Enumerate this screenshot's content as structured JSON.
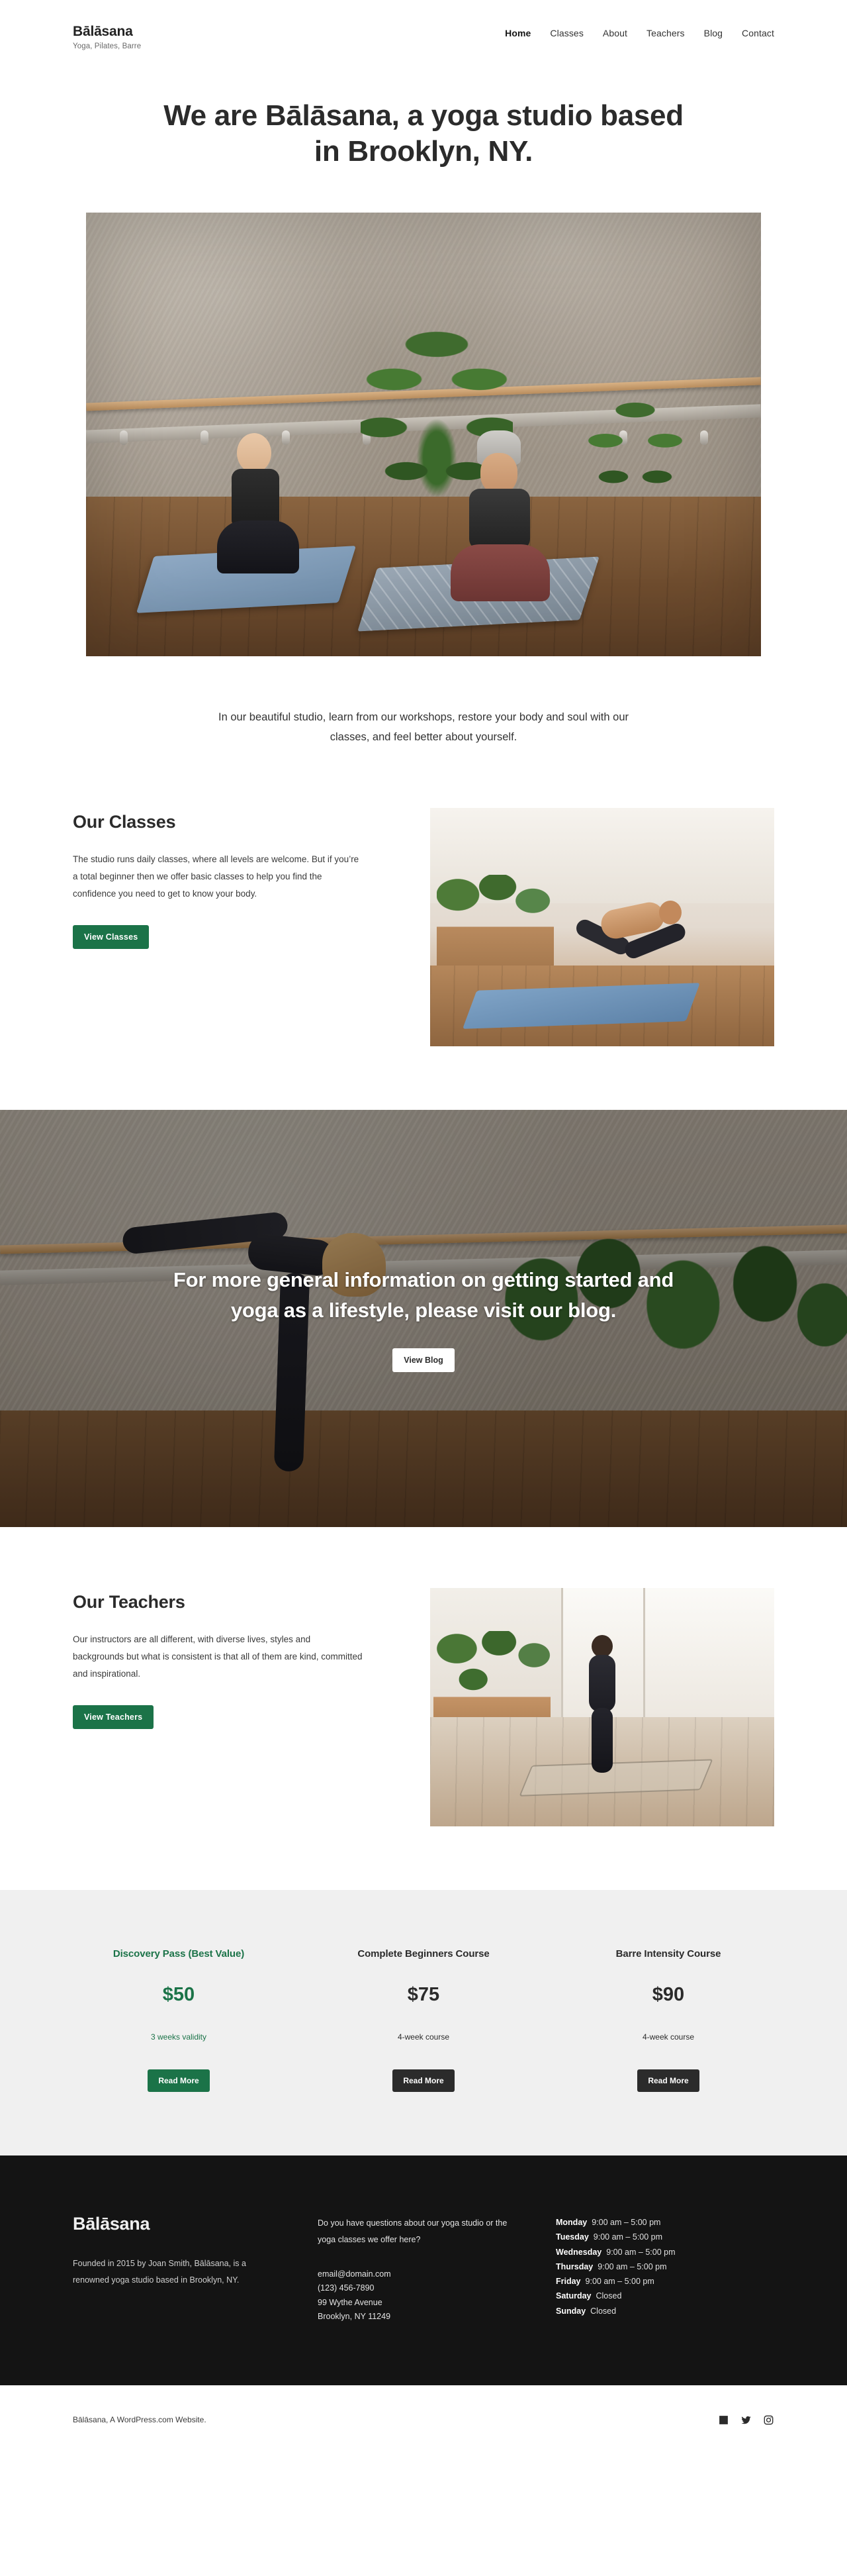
{
  "header": {
    "brand_title": "Bālāsana",
    "brand_tagline": "Yoga, Pilates, Barre",
    "nav": [
      {
        "label": "Home",
        "active": true
      },
      {
        "label": "Classes",
        "active": false
      },
      {
        "label": "About",
        "active": false
      },
      {
        "label": "Teachers",
        "active": false
      },
      {
        "label": "Blog",
        "active": false
      },
      {
        "label": "Contact",
        "active": false
      }
    ]
  },
  "hero": {
    "heading": "We are Bālāsana, a yoga studio based in Brooklyn, NY.",
    "image_alt": "Two people meditating cross-legged on yoga mats in a studio with concrete walls, a wooden barre and large palm plants",
    "intro": "In our beautiful studio, learn from our workshops, restore your body and soul with our classes, and feel better about yourself."
  },
  "classes_section": {
    "heading": "Our Classes",
    "body": "The studio runs daily classes, where all levels are welcome. But if you’re a total beginner then we offer basic classes to help you find the confidence you need to get to know your body.",
    "button_label": "View Classes",
    "image_alt": "Person in extended side angle yoga pose on a blue mat beside potted plants"
  },
  "blog_banner": {
    "heading": "For more general information on getting started and yoga as a lifestyle, please visit our blog.",
    "button_label": "View Blog",
    "image_alt": "Woman holding standing balance pose in a studio with plants in woven baskets"
  },
  "teachers_section": {
    "heading": "Our Teachers",
    "body": "Our instructors are all different, with diverse lives, styles and backgrounds but what is consistent is that all of them are kind, committed and inspirational.",
    "button_label": "View Teachers",
    "image_alt": "Person standing on a yoga mat by a bright window with potted plants"
  },
  "pricing": {
    "cards": [
      {
        "title": "Discovery Pass (Best Value)",
        "price": "$50",
        "note": "3 weeks validity",
        "button_label": "Read More",
        "style": "green"
      },
      {
        "title": "Complete Beginners Course",
        "price": "$75",
        "note": "4-week course",
        "button_label": "Read More",
        "style": "dark"
      },
      {
        "title": "Barre Intensity Course",
        "price": "$90",
        "note": "4-week course",
        "button_label": "Read More",
        "style": "dark"
      }
    ]
  },
  "footer": {
    "brand": "Bālāsana",
    "about": "Founded in 2015 by Joan Smith, Bālāsana, is a renowned yoga studio based in Brooklyn, NY.",
    "questions": "Do you have questions about our yoga studio or the yoga classes we offer here?",
    "email": "email@domain.com",
    "phone": "(123) 456-7890",
    "address_line1": "99 Wythe Avenue",
    "address_line2": "Brooklyn, NY 11249",
    "hours": [
      {
        "day": "Monday",
        "time": "9:00 am – 5:00 pm"
      },
      {
        "day": "Tuesday",
        "time": "9:00 am – 5:00 pm"
      },
      {
        "day": "Wednesday",
        "time": "9:00 am – 5:00 pm"
      },
      {
        "day": "Thursday",
        "time": "9:00 am – 5:00 pm"
      },
      {
        "day": "Friday",
        "time": "9:00 am – 5:00 pm"
      },
      {
        "day": "Saturday",
        "time": "Closed"
      },
      {
        "day": "Sunday",
        "time": "Closed"
      }
    ]
  },
  "bottom_bar": {
    "credit": "Bālāsana, A WordPress.com Website.",
    "socials": [
      {
        "name": "facebook-icon"
      },
      {
        "name": "twitter-icon"
      },
      {
        "name": "instagram-icon"
      }
    ]
  },
  "colors": {
    "accent_green": "#1b7348",
    "dark": "#2b2b2b",
    "pricing_bg": "#f0f0f0",
    "footer_bg": "#141414"
  }
}
